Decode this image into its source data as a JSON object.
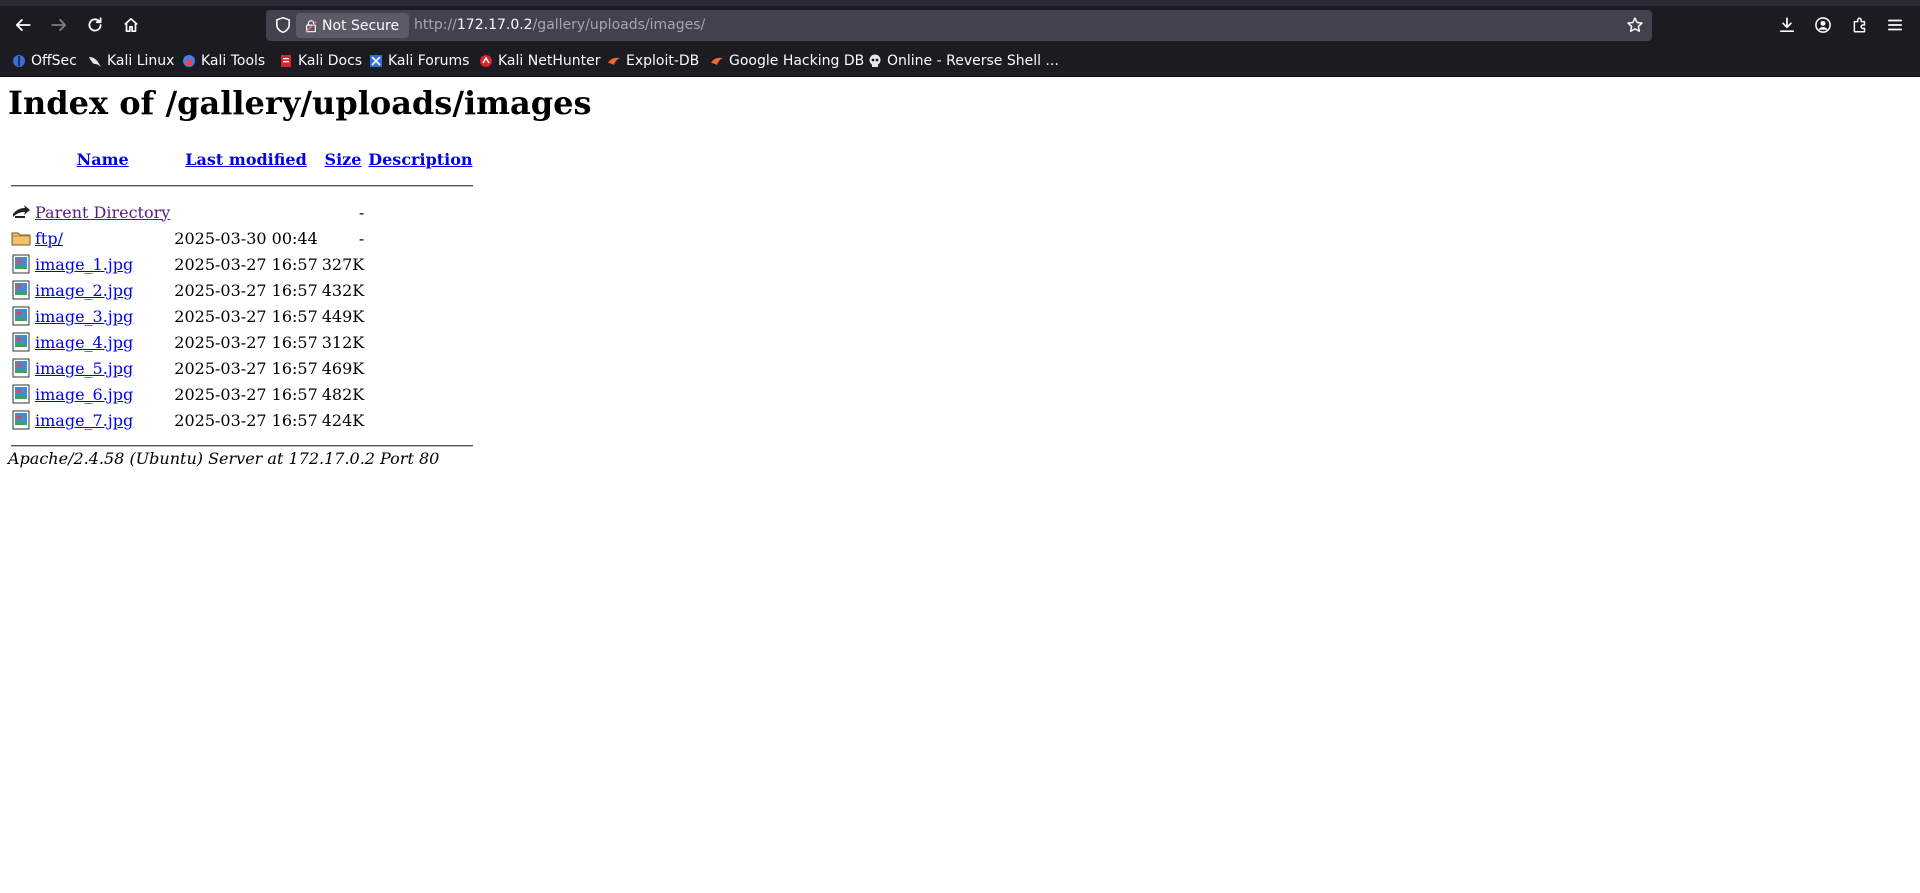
{
  "browser": {
    "security_label": "Not Secure",
    "url_prefix": "http://",
    "url_host": "172.17.0.2",
    "url_path": "/gallery/uploads/images/",
    "bookmarks": [
      {
        "label": "OffSec",
        "icon": "offsec-icon"
      },
      {
        "label": "Kali Linux",
        "icon": "kali-dragon-icon"
      },
      {
        "label": "Kali Tools",
        "icon": "kali-tools-icon"
      },
      {
        "label": "Kali Docs",
        "icon": "kali-docs-icon"
      },
      {
        "label": "Kali Forums",
        "icon": "kali-forums-icon"
      },
      {
        "label": "Kali NetHunter",
        "icon": "nethunter-icon"
      },
      {
        "label": "Exploit-DB",
        "icon": "exploit-db-icon"
      },
      {
        "label": "Google Hacking DB",
        "icon": "ghdb-icon"
      },
      {
        "label": "Online - Reverse Shell ...",
        "icon": "skull-icon"
      }
    ]
  },
  "page": {
    "title": "Index of /gallery/uploads/images",
    "columns": {
      "name": "Name",
      "last_modified": "Last modified",
      "size": "Size",
      "description": "Description"
    },
    "rows": [
      {
        "name": "Parent Directory",
        "modified": "",
        "size": "-",
        "icon": "back-arrow-icon"
      },
      {
        "name": "ftp/",
        "modified": "2025-03-30 00:44",
        "size": "-",
        "icon": "folder-icon"
      },
      {
        "name": "image_1.jpg",
        "modified": "2025-03-27 16:57",
        "size": "327K",
        "icon": "image-file-icon"
      },
      {
        "name": "image_2.jpg",
        "modified": "2025-03-27 16:57",
        "size": "432K",
        "icon": "image-file-icon"
      },
      {
        "name": "image_3.jpg",
        "modified": "2025-03-27 16:57",
        "size": "449K",
        "icon": "image-file-icon"
      },
      {
        "name": "image_4.jpg",
        "modified": "2025-03-27 16:57",
        "size": "312K",
        "icon": "image-file-icon"
      },
      {
        "name": "image_5.jpg",
        "modified": "2025-03-27 16:57",
        "size": "469K",
        "icon": "image-file-icon"
      },
      {
        "name": "image_6.jpg",
        "modified": "2025-03-27 16:57",
        "size": "482K",
        "icon": "image-file-icon"
      },
      {
        "name": "image_7.jpg",
        "modified": "2025-03-27 16:57",
        "size": "424K",
        "icon": "image-file-icon"
      }
    ],
    "footer": "Apache/2.4.58 (Ubuntu) Server at 172.17.0.2 Port 80"
  },
  "colors": {
    "link": "#0000ee",
    "visited_link": "#551a8b",
    "chrome_bg": "#1c1b22",
    "urlbar_bg": "#42414d"
  }
}
